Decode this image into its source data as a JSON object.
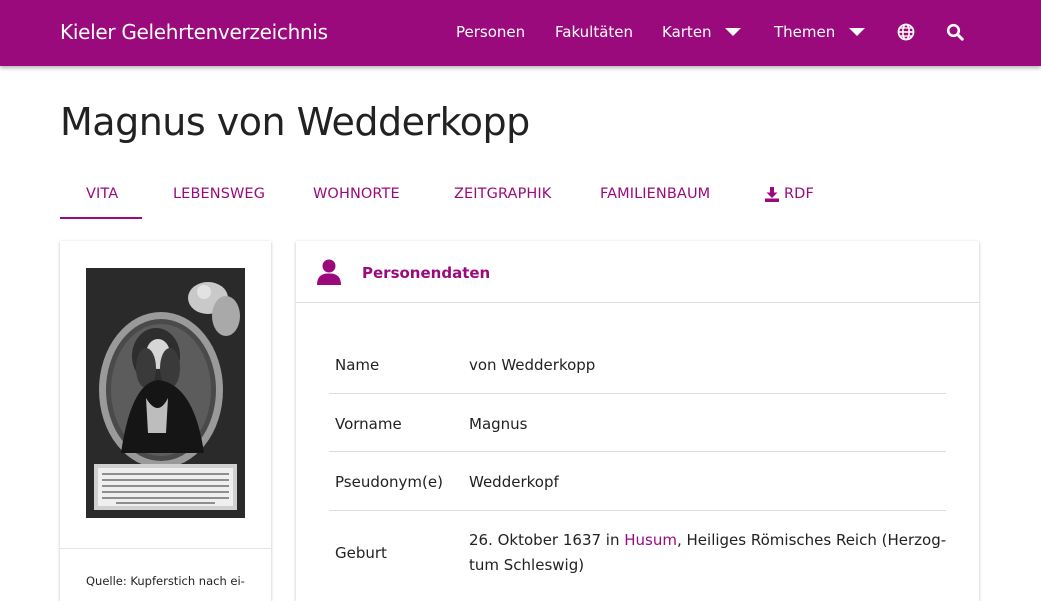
{
  "brand": "Kieler Gelehrtenverzeichnis",
  "nav": {
    "personen": "Personen",
    "fakultaeten": "Fakultäten",
    "karten": "Karten",
    "themen": "Themen"
  },
  "icons": {
    "language": "globe-icon",
    "search": "search-icon",
    "person": "person-icon",
    "download": "download-icon"
  },
  "colors": {
    "accent": "#9b0a7d"
  },
  "page_title": "Magnus von Wedderkopp",
  "tabs": {
    "vita": "Vita",
    "lebensweg": "Lebensweg",
    "wohnorte": "Wohnorte",
    "zeitgraphik": "Zeitgraphik",
    "familienbaum": "Familienbaum",
    "rdf": "RDF"
  },
  "active_tab": "Vita",
  "source_text": "Quelle: Kupferstich nach ei-",
  "card": {
    "title": "Personendaten",
    "rows": [
      {
        "label": "Name",
        "value": "von Wedderkopp"
      },
      {
        "label": "Vorname",
        "value": "Magnus"
      },
      {
        "label": "Pseudonym(e)",
        "value": "Wedderkopf"
      },
      {
        "label": "Geburt",
        "value_prefix": "26. Oktober 1637 in ",
        "value_link": "Husum",
        "value_suffix": ", Heiliges Römisches Reich (Herzog-",
        "value_line2": "tum Schleswig)"
      }
    ]
  }
}
